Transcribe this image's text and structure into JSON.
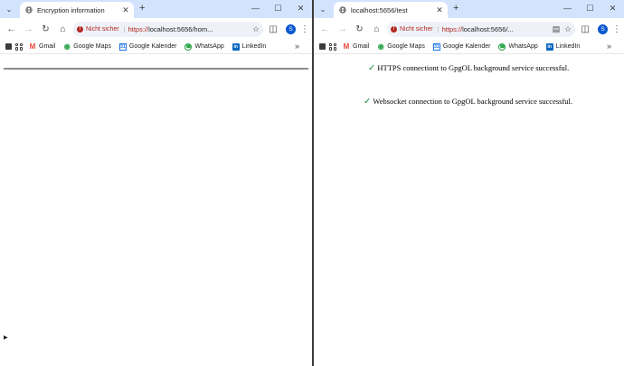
{
  "left": {
    "tab_title": "Encryption information",
    "security_chip": "Nicht sicher",
    "url_scheme": "https://",
    "url_rest": "localhost:5656/hom...",
    "avatar_letter": "S"
  },
  "right": {
    "tab_title": "localhost:5656/test",
    "security_chip": "Nicht sicher",
    "url_scheme": "https://",
    "url_rest": "localhost:5656/...",
    "avatar_letter": "S",
    "messages": [
      "HTTPS connectiont to GpgOL background service successful.",
      "Websocket connection to GpgOL background service successful."
    ]
  },
  "bookmarks": {
    "gmail": "Gmail",
    "maps": "Google Maps",
    "calendar": "Google Kalender",
    "whatsapp": "WhatsApp",
    "linkedin": "LinkedIn"
  },
  "colors": {
    "tabstrip": "#d3e3fd",
    "insecure_red": "#b3261e",
    "check_green": "#1e8e3e",
    "avatar_blue": "#0b57d0"
  },
  "icons": {
    "tab_search": "chevron-down-icon",
    "close": "close-icon",
    "new_tab": "plus-icon",
    "back": "arrow-left-icon",
    "forward": "arrow-right-icon",
    "reload": "reload-icon",
    "home": "home-icon",
    "star": "star-icon",
    "extensions": "puzzle-icon",
    "menu": "kebab-menu-icon",
    "translate": "translate-icon"
  }
}
